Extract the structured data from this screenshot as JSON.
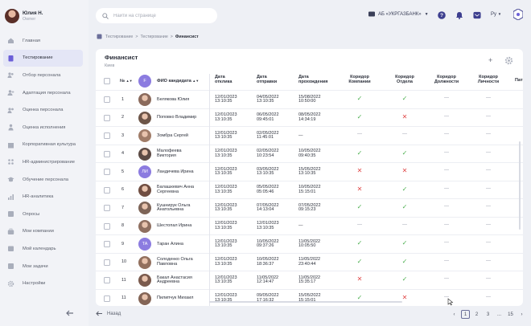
{
  "user": {
    "name": "Юлия Н.",
    "role": "Owner"
  },
  "sidebar": {
    "items": [
      {
        "label": "Главная",
        "icon": "home-icon",
        "active": false
      },
      {
        "label": "Тестирование",
        "icon": "clipboard-icon",
        "active": true
      },
      {
        "label": "Отбор персонала",
        "icon": "users-icon",
        "active": false
      },
      {
        "label": "Адаптация персонала",
        "icon": "user-plus-icon",
        "active": false
      },
      {
        "label": "Оценка персонала",
        "icon": "users-star-icon",
        "active": false
      },
      {
        "label": "Оценка исполнения",
        "icon": "person-check-icon",
        "active": false
      },
      {
        "label": "Корпоративная культура",
        "icon": "building-icon",
        "active": false
      },
      {
        "label": "HR-администрирование",
        "icon": "admin-icon",
        "active": false
      },
      {
        "label": "Обучение персонала",
        "icon": "graduation-icon",
        "active": false
      },
      {
        "label": "HR-аналитика",
        "icon": "chart-icon",
        "active": false
      },
      {
        "label": "Опросы",
        "icon": "poll-icon",
        "active": false
      },
      {
        "label": "Мои компании",
        "icon": "briefcase-icon",
        "active": false
      },
      {
        "label": "Мой календарь",
        "icon": "calendar-icon",
        "active": false
      },
      {
        "label": "Мои задачи",
        "icon": "tasks-icon",
        "active": false
      },
      {
        "label": "Настройки",
        "icon": "gear-icon",
        "active": false
      }
    ]
  },
  "search": {
    "placeholder": "Найти на странице"
  },
  "company": {
    "label": "АБ «УКРГАЗБАНК»"
  },
  "lang": "Ру",
  "breadcrumb": {
    "items": [
      "Тестирование",
      "Тестирование"
    ],
    "current": "Финансист"
  },
  "page": {
    "title": "Финансист",
    "subtitle": "Киев"
  },
  "table": {
    "headers": {
      "num": "№",
      "name": "ФИО кандидата",
      "d1": "Дата\nотклика",
      "d2": "Дата\nотправки",
      "d3": "Дата\nпрохождения",
      "c1": "Коридор\nКомпании",
      "c2": "Коридор\nОтдела",
      "c3": "Коридор\nДолжности",
      "c4": "Коридор\nЛичности",
      "c5": "Пат"
    },
    "header_avatar_initial": "F",
    "rows": [
      {
        "n": "1",
        "name": "Белякова Юлия",
        "initials": "",
        "d1": "12/01/2023\n13:10:35",
        "d2": "04/05/2022\n13:10:35",
        "d3": "15/08/2022\n10:50:00",
        "c": [
          "ok",
          "ok",
          "dash",
          "dash"
        ]
      },
      {
        "n": "2",
        "name": "Поповко Владимир",
        "initials": "",
        "d1": "12/01/2023\n13:10:35",
        "d2": "06/05/2022\n09:45:01",
        "d3": "08/05/2022\n14:34:19",
        "c": [
          "ok",
          "no",
          "dash",
          "dash"
        ]
      },
      {
        "n": "3",
        "name": "Зомбра Сергей",
        "initials": "",
        "d1": "12/01/2023\n13:10:35",
        "d2": "02/05/2022\n11:45:01",
        "d3": "—",
        "c": [
          "dash",
          "dash",
          "dash",
          "dash"
        ]
      },
      {
        "n": "4",
        "name": "Малофеева\nВиктория",
        "initials": "",
        "d1": "12/01/2023\n13:10:35",
        "d2": "02/05/2022\n10:23:54",
        "d3": "10/05/2022\n09:40:35",
        "c": [
          "ok",
          "ok",
          "dash",
          "dash"
        ]
      },
      {
        "n": "5",
        "name": "Ландичева Ирина",
        "initials": "ЛИ",
        "d1": "12/01/2023\n13:10:35",
        "d2": "03/05/2022\n13:10:35",
        "d3": "15/05/2022\n13:10:35",
        "c": [
          "no",
          "no",
          "dash",
          "dash"
        ]
      },
      {
        "n": "6",
        "name": "Балашкевич Анна\nСергеевна",
        "initials": "",
        "d1": "12/01/2023\n13:10:35",
        "d2": "05/05/2022\n05:05:46",
        "d3": "10/05/2022\n15:15:01",
        "c": [
          "no",
          "ok",
          "dash",
          "dash"
        ]
      },
      {
        "n": "7",
        "name": "Кушнирук Ольга\nАнатольевна",
        "initials": "",
        "d1": "12/01/2023\n13:10:35",
        "d2": "07/05/2022\n14:13:04",
        "d3": "07/05/2022\n09:15:23",
        "c": [
          "ok",
          "ok",
          "dash",
          "dash"
        ]
      },
      {
        "n": "8",
        "name": "Шестопал Ирина",
        "initials": "",
        "d1": "12/01/2023\n13:10:35",
        "d2": "12/01/2023\n13:10:35",
        "d3": "—",
        "c": [
          "dash",
          "dash",
          "dash",
          "dash"
        ]
      },
      {
        "n": "9",
        "name": "Таран Алина",
        "initials": "ТА",
        "d1": "12/01/2023\n13:10:35",
        "d2": "10/05/2022\n09:37:26",
        "d3": "11/05/2022\n10:05:50",
        "c": [
          "ok",
          "ok",
          "dash",
          "dash"
        ]
      },
      {
        "n": "10",
        "name": "Солоденко Ольга\nПавловна",
        "initials": "",
        "d1": "12/01/2023\n13:10:35",
        "d2": "10/05/2022\n18:36:37",
        "d3": "11/05/2022\n23:40:44",
        "c": [
          "ok",
          "ok",
          "dash",
          "dash"
        ]
      },
      {
        "n": "11",
        "name": "Бакал Анастасия\nАндреевна",
        "initials": "",
        "d1": "12/01/2023\n13:10:35",
        "d2": "11/05/2022\n12:14:47",
        "d3": "11/05/2022\n15:35:17",
        "c": [
          "no",
          "ok",
          "dash",
          "dash"
        ]
      },
      {
        "n": "11",
        "name": "Пилипчук Михаил",
        "initials": "",
        "d1": "12/01/2023\n13:10:35",
        "d2": "09/05/2022\n17:16:32",
        "d3": "15/05/2022\n15:15:01",
        "c": [
          "ok",
          "no",
          "dash",
          "dash"
        ]
      }
    ]
  },
  "footer": {
    "back_label": "Назад",
    "pages": [
      "1",
      "2",
      "3",
      "...",
      "15"
    ],
    "current_page": "1"
  },
  "colors": {
    "accent": "#6b5fd8",
    "ok": "#4caf50",
    "no": "#e04848",
    "sidebar_bg": "#f2f3f7",
    "page_bg": "#eef0f5"
  }
}
